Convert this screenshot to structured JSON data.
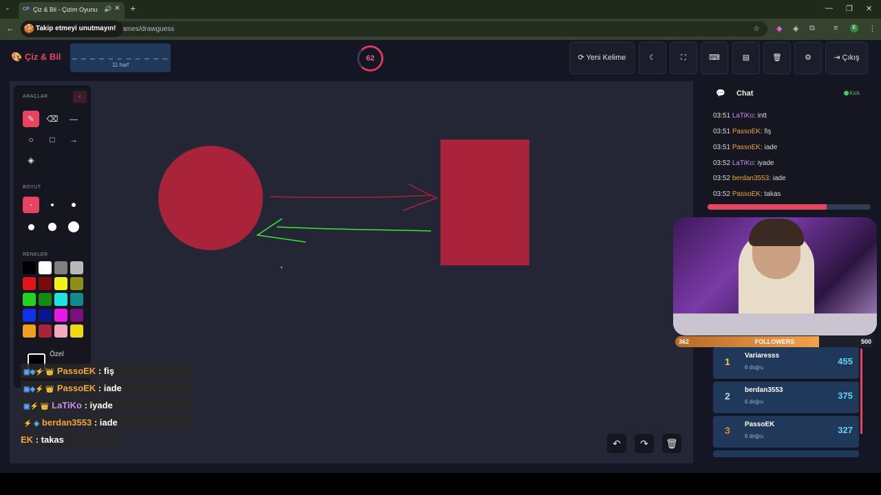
{
  "browser": {
    "tab_title": "Çiz & Bil - Çizim Oyunu",
    "tab_favicon": "CP",
    "url": "games/drawguess",
    "notice": "Takip etmeyi unutmayın!"
  },
  "header": {
    "logo": "Çiz & Bil",
    "word_mask": "_ _ _ _ _ _ _ _ _ _ _",
    "word_length": "11 harf",
    "timer": "62",
    "new_word": "Yeni Kelime",
    "exit": "Çıkış"
  },
  "tools": {
    "tools_label": "ARAÇLAR",
    "size_label": "BOYUT",
    "colors_label": "RENKLER",
    "custom_label": "Özel",
    "palette": [
      "#000000",
      "#ffffff",
      "#808080",
      "#b8b8b8",
      "#e31515",
      "#7a0b0b",
      "#f2f21b",
      "#8f8f17",
      "#22d322",
      "#128a12",
      "#1fe3e3",
      "#0f8a8a",
      "#1131e6",
      "#0a1690",
      "#ea17ea",
      "#7d0f7d",
      "#f0a020",
      "#a9243a",
      "#f2a8bd",
      "#efd814"
    ]
  },
  "overlay_chat": [
    {
      "user": "PassoEK",
      "text": ": fiş"
    },
    {
      "user": "PassoEK",
      "text": ": iade"
    },
    {
      "user": "LaTiKo",
      "text": ": iyade"
    },
    {
      "user": "berdan3553",
      "text": ": iade"
    },
    {
      "user": "EK",
      "text": ": takas"
    }
  ],
  "chat": {
    "title": "Chat",
    "status": "Kick",
    "messages": [
      {
        "time": "03:51",
        "user": "LaTiKo",
        "text": ": intt"
      },
      {
        "time": "03:51",
        "user": "PassoEK",
        "text": ": fiş"
      },
      {
        "time": "03:51",
        "user": "PassoEK",
        "text": ": iade"
      },
      {
        "time": "03:52",
        "user": "LaTiKo",
        "text": ": iyade"
      },
      {
        "time": "03:52",
        "user": "berdan3553",
        "text": ": iade"
      },
      {
        "time": "03:52",
        "user": "PassoEK",
        "text": ": takas"
      }
    ],
    "progress_fraction": 0.73
  },
  "followers": {
    "label": "FOLLOWERS",
    "current": "362",
    "goal": "500"
  },
  "leaderboard": [
    {
      "rank": "1",
      "name": "Variaresss",
      "sub": "6 doğru",
      "score": "455",
      "color": "#f2cf2a"
    },
    {
      "rank": "2",
      "name": "berdan3553",
      "sub": "6 doğru",
      "score": "375",
      "color": "#c9d3e2"
    },
    {
      "rank": "3",
      "name": "PassoEK",
      "sub": "6 doğru",
      "score": "327",
      "color": "#e08a35"
    }
  ],
  "colors": {
    "accent": "#e8445f",
    "panel": "#15161f",
    "canvas": "#252635",
    "drawing_red": "#a9243a",
    "drawing_green": "#39e83a"
  }
}
